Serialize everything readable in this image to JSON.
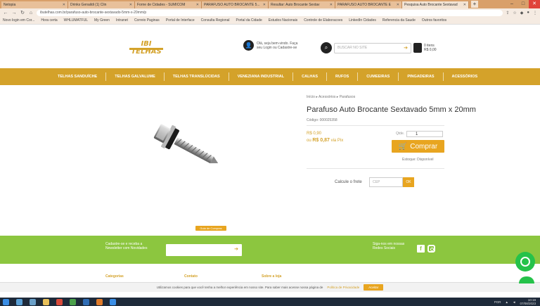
{
  "browser": {
    "tabs": [
      {
        "label": "Netopia",
        "active": false
      },
      {
        "label": "Drinks Genaildi (1) Clin",
        "active": false
      },
      {
        "label": "Forne de Cidades - SUMICOM",
        "active": false
      },
      {
        "label": "PARAFUSO AUTO BROCANTE 5...",
        "active": false
      },
      {
        "label": "Resultar: Auto Brocante Sextav",
        "active": false
      },
      {
        "label": "PARAFUSO AUTO BROCANTE E",
        "active": false
      },
      {
        "label": "Pesquisa Auto Brocante Sextavad",
        "active": true
      }
    ],
    "url": "ibutelhas.com.br/parafuso-auto-brocante-sextavado-5mm-x-20mm/p",
    "bookmarks": [
      "Novo login em Cor...",
      "Hora certa",
      "WHLUMATFUL",
      "My Green",
      "Intranet",
      "Correio Paginas",
      "Portal de Interface",
      "Consulta Regional",
      "Portal da Cidade",
      "Estudos Nacionais",
      "Controle de Elaboracoes",
      "LinkedIn Cidades",
      "Referencia da Saude",
      "Outros favoritos"
    ]
  },
  "header": {
    "logo": "IBI TELHAS",
    "account_text": "Olá, seja bem-vindo. Faça seu Login ou Cadastre-se",
    "search_placeholder": "BUSCAR NO SITE",
    "cart_label": "0 itens",
    "cart_total": "R$ 0,00"
  },
  "nav": [
    "TELHAS SANDUÍCHE",
    "TELHAS GALVALUME",
    "TELHAS TRANSLÚCIDAS",
    "VENEZIANA INDUSTRIAL",
    "CALHAS",
    "RUFOS",
    "CUMEEIRAS",
    "PINGADEIRAS",
    "ACESSÓRIOS"
  ],
  "product": {
    "breadcrumb": "Início ▸ Acessórios ▸ Parafusos",
    "title": "Parafuso Auto Brocante Sextavado 5mm x 20mm",
    "sku": "Código: 000025358",
    "price_old": "R$ 0,90",
    "price_prefix": "ou",
    "price_new": "R$ 0,87",
    "price_suffix": "via Pix",
    "qty_label": "Qtde.",
    "qty_value": "1",
    "buy_label": "Comprar",
    "availability": "Estoque: Disponível",
    "shipping_label": "Calcule o frete",
    "cep_placeholder": "CEP",
    "ok_label": "OK",
    "guide_link": "Guia de Compras"
  },
  "newsletter": {
    "text": "Cadastre-se e receba a Newsletter com Novidades",
    "social_text": "Siga-nos em nossas Redes Sociais"
  },
  "footer": {
    "columns": [
      "Categorias",
      "Contato",
      "Sobre a loja"
    ],
    "cookie_text": "Utilizamos cookies para que você tenha a melhor experiência em nosso site. Para saber mais acesse nossa página de",
    "cookie_link": "Política de Privacidade",
    "cookie_button": "Aceitar"
  },
  "taskbar": {
    "lang": "POR",
    "time": "10:19",
    "date": "07/08/2023"
  },
  "colors": {
    "brand_gold": "#d4a22a",
    "button_orange": "#e8a520",
    "newsletter_green": "#8cc63f",
    "whatsapp_green": "#25c24a"
  }
}
